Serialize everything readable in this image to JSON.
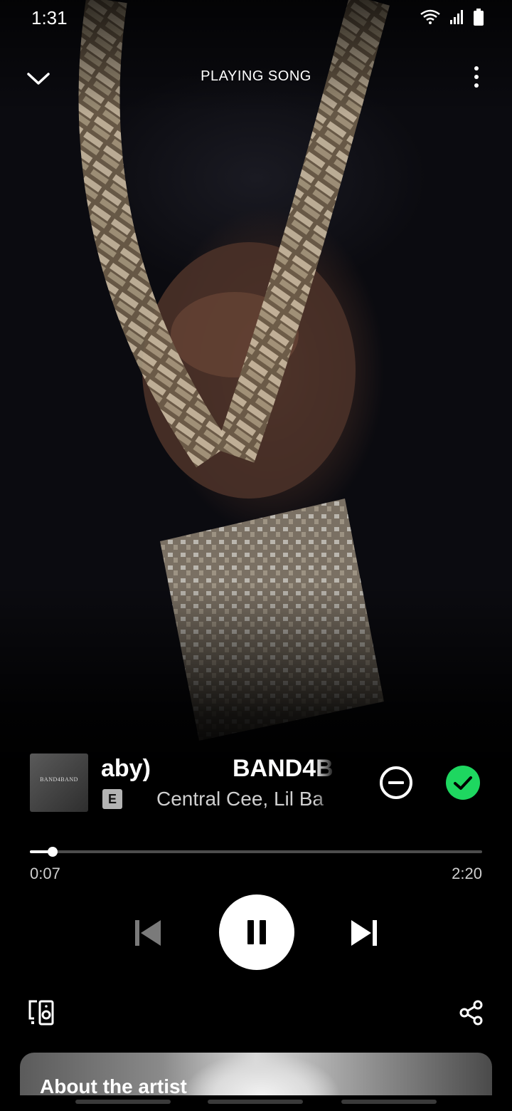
{
  "status_bar": {
    "time": "1:31"
  },
  "header": {
    "title": "PLAYING SONG"
  },
  "thumbnail": {
    "text": "BAND4BAND"
  },
  "track": {
    "title_part_a": "aby)",
    "title_part_b": "BAND4B",
    "explicit_label": "E",
    "artists": "Central Cee, Lil Ba"
  },
  "progress": {
    "elapsed": "0:07",
    "total": "2:20",
    "fraction": 0.05
  },
  "playback": {
    "state": "playing"
  },
  "colors": {
    "accent_green": "#1ed760",
    "background": "#000000"
  },
  "artist_card": {
    "heading": "About the artist"
  }
}
